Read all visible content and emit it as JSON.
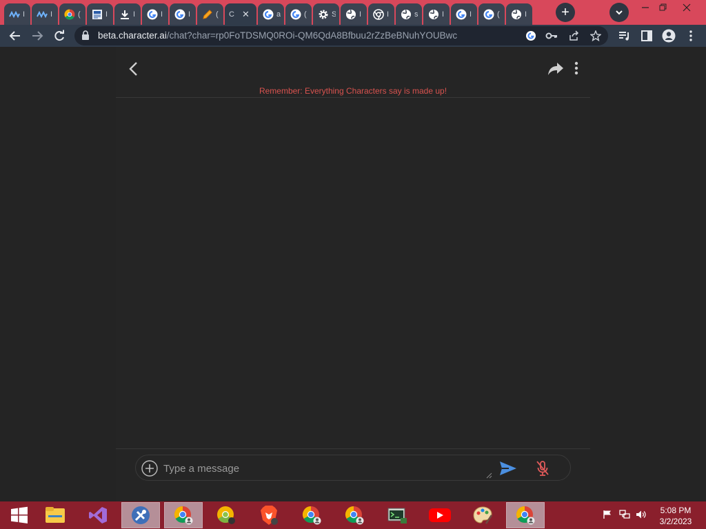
{
  "browser": {
    "tabs": [
      {
        "title": "I",
        "icon": "wave-logo-icon"
      },
      {
        "title": "I",
        "icon": "wave-logo-icon"
      },
      {
        "title": "(",
        "icon": "chrome-logo-icon"
      },
      {
        "title": "I",
        "icon": "news-icon"
      },
      {
        "title": "I",
        "icon": "download-icon"
      },
      {
        "title": "I",
        "icon": "google-g-icon"
      },
      {
        "title": "I",
        "icon": "google-g-icon"
      },
      {
        "title": "(",
        "icon": "pencil-icon"
      },
      {
        "title": "C",
        "icon": "none",
        "active": true
      },
      {
        "title": "a",
        "icon": "google-g-icon"
      },
      {
        "title": "(",
        "icon": "google-g-icon"
      },
      {
        "title": "S",
        "icon": "gear-icon"
      },
      {
        "title": "I",
        "icon": "globe-icon"
      },
      {
        "title": "I",
        "icon": "chrome-outline-icon"
      },
      {
        "title": "s",
        "icon": "globe-icon"
      },
      {
        "title": "I",
        "icon": "globe-icon"
      },
      {
        "title": "I",
        "icon": "google-g-icon"
      },
      {
        "title": "(",
        "icon": "google-g-icon"
      },
      {
        "title": "I",
        "icon": "globe-icon"
      }
    ],
    "new_tab_label": "+",
    "url_host": "beta.character.ai",
    "url_path": "/chat?char=rp0FoTDSMQ0ROi-QM6QdA8Bfbuu2rZzBeBNuhYOUBwc",
    "colors": {
      "tabstrip": "#d8485b",
      "toolbar": "#303b4a"
    }
  },
  "chat": {
    "disclaimer": "Remember: Everything Characters say is made up!",
    "input_placeholder": "Type a message",
    "input_value": "",
    "colors": {
      "disclaimer": "#d9534f",
      "send": "#4b8fe0",
      "mic_muted": "#e05a5a"
    }
  },
  "taskbar": {
    "apps": [
      "file-explorer-icon",
      "visual-studio-icon",
      "tools-icon",
      "chrome-profile-icon",
      "chrome-canary-icon",
      "brave-icon",
      "chrome-profile-icon",
      "chrome-profile-icon",
      "terminal-icon",
      "youtube-icon",
      "paint-icon",
      "chrome-profile-icon"
    ],
    "time": "5:08 PM",
    "date": "3/2/2023"
  }
}
